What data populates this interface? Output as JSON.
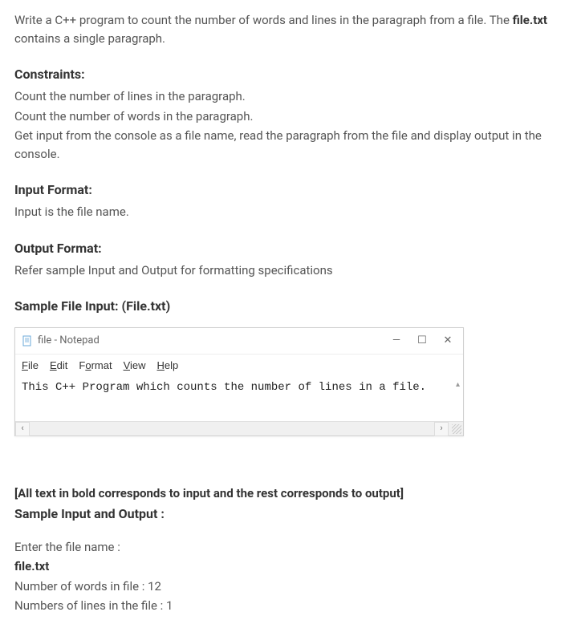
{
  "intro": {
    "prefix": "Write a C++ program to count the number of words and lines in the paragraph from a file. The ",
    "bold": "file.txt",
    "suffix": " contains a single paragraph."
  },
  "constraints": {
    "heading": "Constraints:",
    "lines": [
      "Count the number of lines in the paragraph.",
      "Count the number of words in the paragraph.",
      "Get input from the console as a file name, read the paragraph from the file and display output in the console."
    ]
  },
  "input_format": {
    "heading": "Input  Format:",
    "body": "Input is the file name."
  },
  "output_format": {
    "heading": "Output Format:",
    "body": "Refer sample Input and Output for formatting specifications"
  },
  "sample_file": {
    "heading": "Sample File Input: (File.txt)"
  },
  "notepad": {
    "title": "file - Notepad",
    "menu": {
      "file": "File",
      "edit": "Edit",
      "format": "Format",
      "view": "View",
      "help": "Help"
    },
    "content": "This C++ Program which counts the number of lines in a file.",
    "controls": {
      "minimize": "—",
      "maximize": "☐",
      "close": "✕"
    }
  },
  "sample_io": {
    "note": "[All text in bold corresponds to input and the rest corresponds to output]",
    "heading": "Sample Input and Output :",
    "lines": [
      {
        "text": "Enter the file name :",
        "bold": false
      },
      {
        "text": "file.txt",
        "bold": true
      },
      {
        "text": "Number of words in file : 12",
        "bold": false
      },
      {
        "text": "Numbers of lines in the file : 1",
        "bold": false
      }
    ]
  }
}
